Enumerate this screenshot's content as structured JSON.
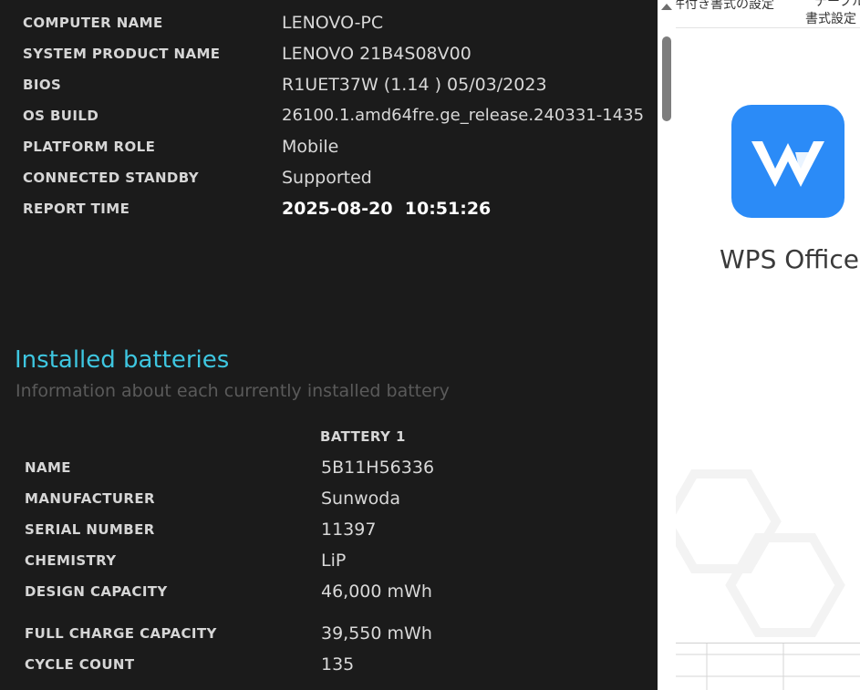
{
  "system_info": [
    {
      "label": "COMPUTER NAME",
      "value": "LENOVO-PC"
    },
    {
      "label": "SYSTEM PRODUCT NAME",
      "value": "LENOVO 21B4S08V00"
    },
    {
      "label": "BIOS",
      "value": "R1UET37W (1.14 ) 05/03/2023"
    },
    {
      "label": "OS BUILD",
      "value": "26100.1.amd64fre.ge_release.240331-1435"
    },
    {
      "label": "PLATFORM ROLE",
      "value": "Mobile"
    },
    {
      "label": "CONNECTED STANDBY",
      "value": "Supported"
    },
    {
      "label": "REPORT TIME",
      "value": "2025-08-20  10:51:26"
    }
  ],
  "batteries": {
    "heading": "Installed batteries",
    "subheading": "Information about each currently installed battery",
    "column_header": "BATTERY 1",
    "rows": [
      {
        "label": "NAME",
        "value": "5B11H56336"
      },
      {
        "label": "MANUFACTURER",
        "value": "Sunwoda"
      },
      {
        "label": "SERIAL NUMBER",
        "value": "11397"
      },
      {
        "label": "CHEMISTRY",
        "value": "LiP"
      },
      {
        "label": "DESIGN CAPACITY",
        "value": "46,000 mWh"
      },
      {
        "label": "FULL CHARGE CAPACITY",
        "value": "39,550 mWh"
      },
      {
        "label": "CYCLE COUNT",
        "value": "135"
      }
    ]
  },
  "wps": {
    "toolbar_left": "件付き書式の設定",
    "toolbar_right_top": "テーブル",
    "toolbar_right_bottom": "書式設定",
    "app_name": "WPS Office",
    "logo_color": "#2b8bf7"
  },
  "colors": {
    "accent": "#3ec6e0",
    "background": "#1b1b1b"
  }
}
